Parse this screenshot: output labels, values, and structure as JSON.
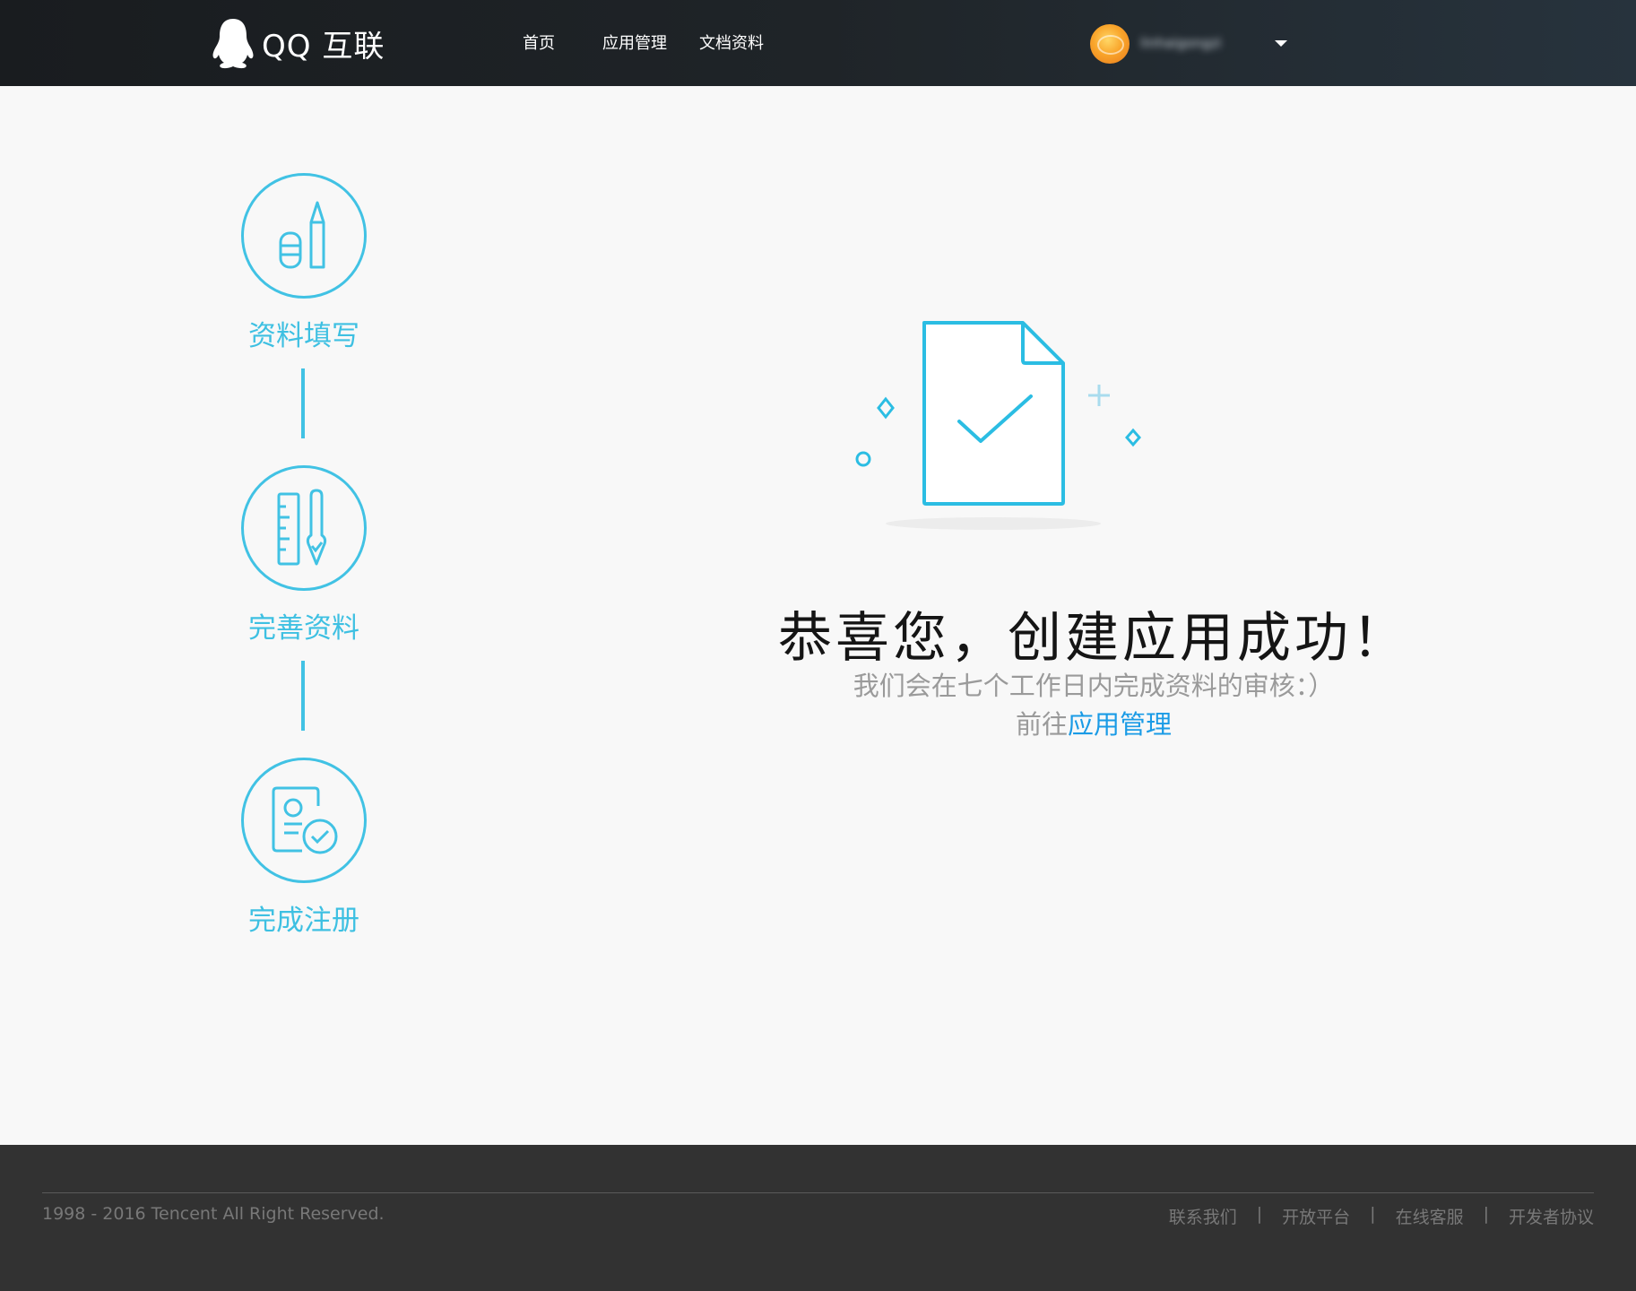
{
  "header": {
    "logo_text": "QQ 互联",
    "nav": [
      {
        "label": "首页"
      },
      {
        "label": "应用管理"
      },
      {
        "label": "文档资料"
      }
    ],
    "user": {
      "name": "linhaigongzi"
    }
  },
  "steps": [
    {
      "label": "资料填写",
      "icon": "pencil-eraser-icon"
    },
    {
      "label": "完善资料",
      "icon": "ruler-pen-icon"
    },
    {
      "label": "完成注册",
      "icon": "id-card-check-icon"
    }
  ],
  "success": {
    "title": "恭喜您，创建应用成功！",
    "subtitle": "我们会在七个工作日内完成资料的审核：）",
    "goto_prefix": "前往",
    "goto_link": "应用管理"
  },
  "footer": {
    "copyright": "1998 - 2016 Tencent All Right Reserved.",
    "links": [
      "联系我们",
      "开放平台",
      "在线客服",
      "开发者协议"
    ],
    "separator": "|"
  },
  "colors": {
    "accent": "#41c2e4",
    "link": "#1a9be6",
    "header_bg": "#1f2428",
    "footer_bg": "#323232",
    "page_bg": "#f8f8f8"
  }
}
